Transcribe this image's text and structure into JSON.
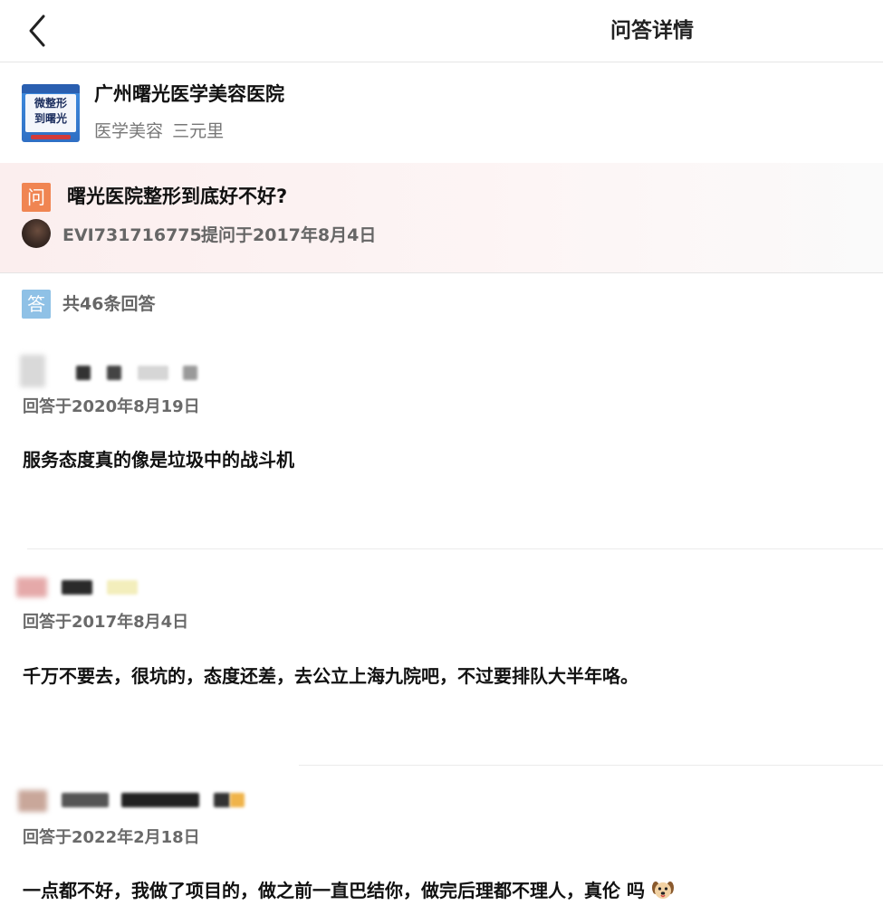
{
  "header": {
    "title": "问答详情"
  },
  "hospital": {
    "name": "广州曙光医学美容医院",
    "category": "医学美容",
    "location": "三元里",
    "logo_lines": [
      "微整形",
      "到曙光"
    ]
  },
  "question": {
    "badge": "问",
    "text": "曙光医院整形到底好不好?",
    "user": "EVI731716775",
    "asked_at": "提问于2017年8月4日"
  },
  "answers_summary": {
    "badge": "答",
    "count_text": "共46条回答"
  },
  "answers": [
    {
      "date": "回答于2020年8月19日",
      "text": "服务态度真的像是垃圾中的战斗机"
    },
    {
      "date": "回答于2017年8月4日",
      "text": "千万不要去，很坑的，态度还差，去公立上海九院吧，不过要排队大半年咯。"
    },
    {
      "date": "回答于2022年2月18日",
      "text": "一点都不好，我做了项目的，做之前一直巴结你，做完后理都不理人，真伦 吗"
    }
  ],
  "colors": {
    "question_badge": "#f08552",
    "answer_badge": "#8fc1e6",
    "question_band": "#fbeeee"
  }
}
